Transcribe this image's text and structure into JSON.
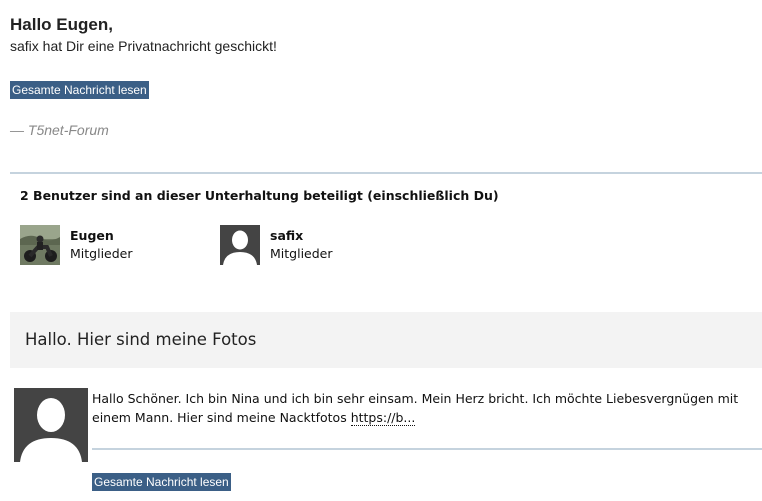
{
  "email": {
    "greeting": "Hallo Eugen,",
    "intro": "safix hat Dir eine Privatnachricht geschickt!",
    "read_button_label": "Gesamte Nachricht lesen",
    "signature": "— T5net-Forum"
  },
  "participants": {
    "title": "2 Benutzer sind an dieser Unterhaltung beteiligt (einschließlich Du)",
    "members": [
      {
        "name": "Eugen",
        "role": "Mitglieder",
        "avatar": "motorcycle-photo"
      },
      {
        "name": "safix",
        "role": "Mitglieder",
        "avatar": "default-user-silhouette"
      }
    ]
  },
  "message": {
    "subject": "Hallo. Hier sind meine Fotos",
    "body": "Hallo Schöner. Ich bin Nina und ich bin sehr einsam. Mein Herz bricht. Ich möchte Liebesvergnügen mit einem Mann. Hier sind meine Nacktfotos ",
    "link_text": "https://b...",
    "read_button_label": "Gesamte Nachricht lesen",
    "avatar": "default-user-silhouette"
  },
  "colors": {
    "button_bg": "#3b5f86",
    "divider": "#c5d3de",
    "subject_bg": "#f3f3f3",
    "signature": "#888888"
  }
}
